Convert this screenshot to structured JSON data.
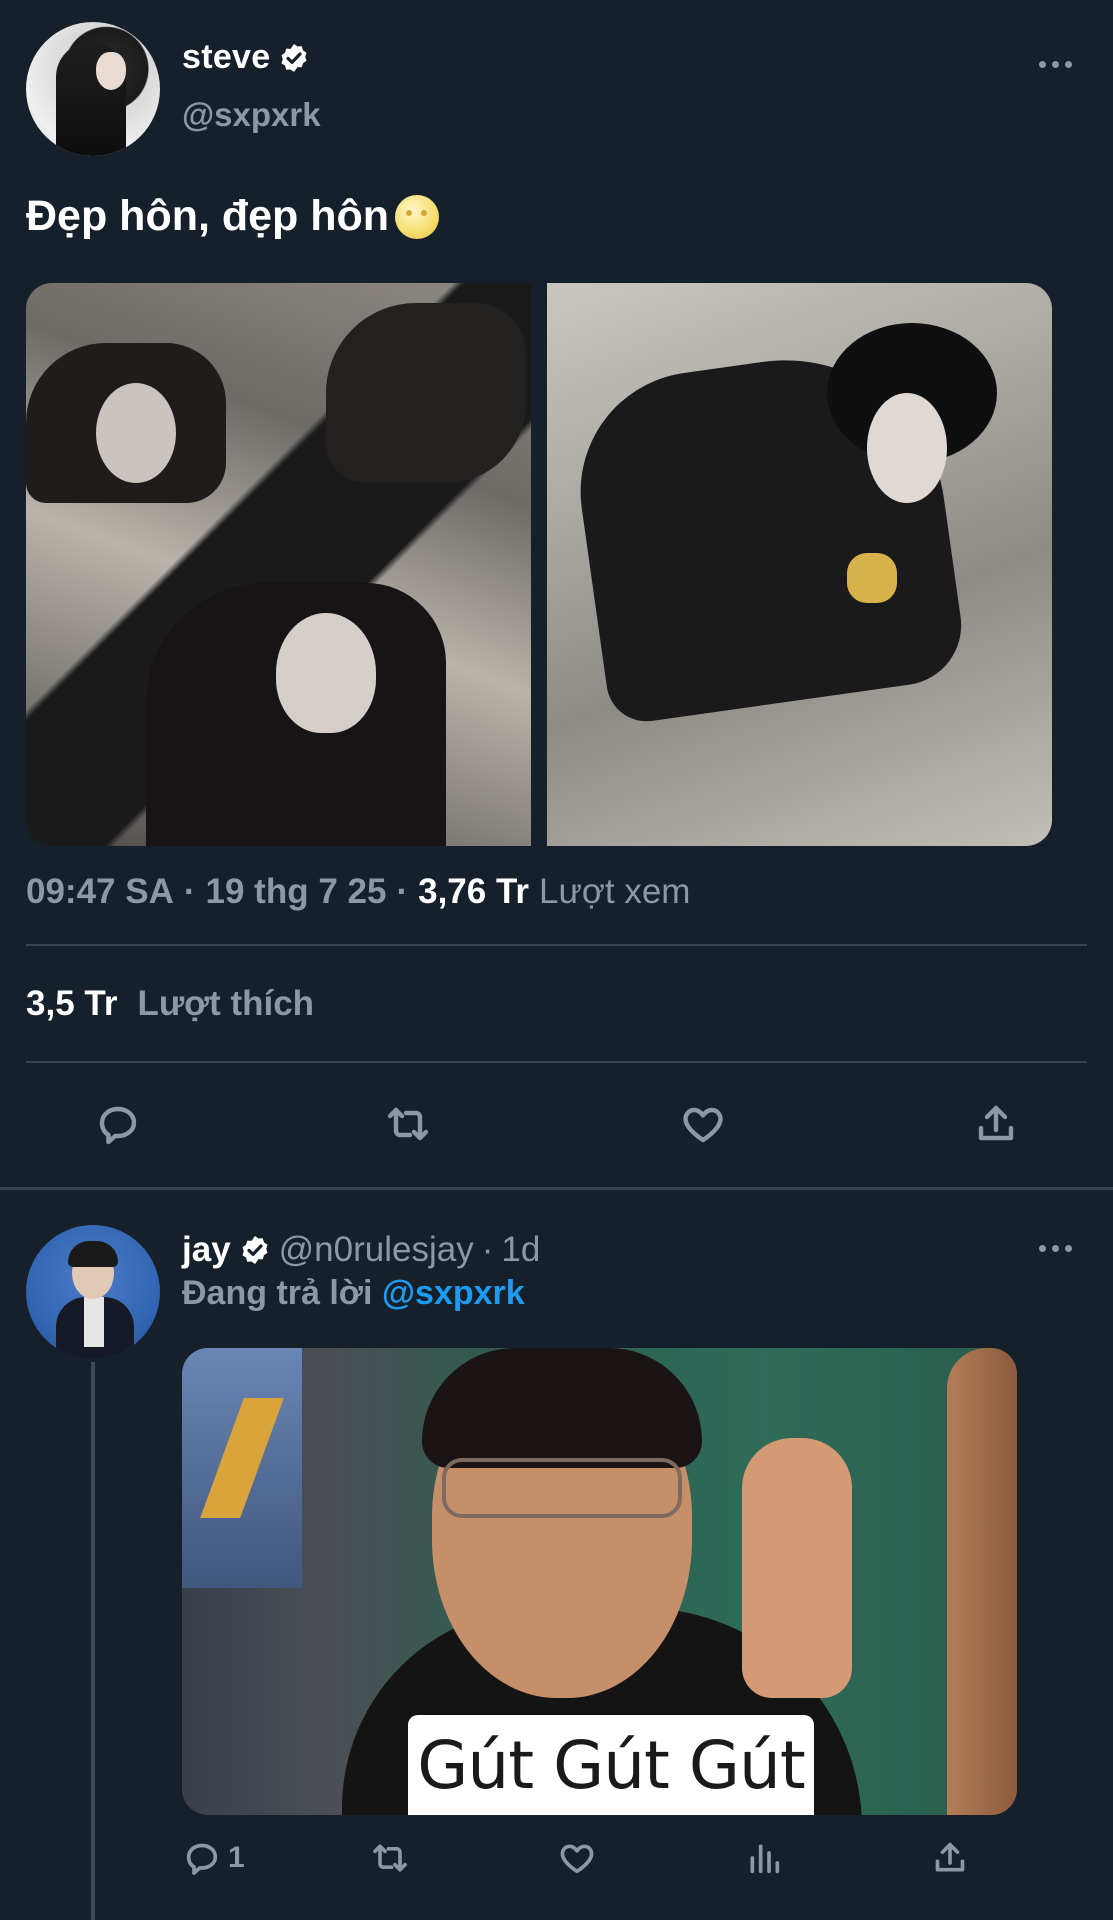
{
  "main_tweet": {
    "author": {
      "display_name": "steve",
      "handle": "@sxpxrk",
      "verified": true
    },
    "text": "Đẹp hôn, đẹp hôn",
    "emoji": "moon-face-emoji",
    "time": "09:47 SA",
    "sep1": "·",
    "date": "19 thg 7 25",
    "sep2": "·",
    "views_count": "3,76 Tr",
    "views_label": "Lượt xem",
    "likes_count": "3,5 Tr",
    "likes_label": "Lượt thích",
    "actions": [
      "reply-icon",
      "retweet-icon",
      "like-icon",
      "share-icon"
    ]
  },
  "reply_tweet": {
    "author": {
      "display_name": "jay",
      "handle": "@n0rulesjay",
      "verified": true
    },
    "sep": "·",
    "time_ago": "1d",
    "replying_prefix": "Đang trả lời",
    "replying_to": "@sxpxrk",
    "image_caption": "Gút Gút Gút",
    "reply_count": "1",
    "actions": [
      "reply-icon",
      "retweet-icon",
      "like-icon",
      "views-icon",
      "share-icon"
    ]
  },
  "colors": {
    "background": "#15202b",
    "secondary_text": "#8b98a5",
    "accent": "#1d9bf0",
    "divider": "#38444d"
  }
}
